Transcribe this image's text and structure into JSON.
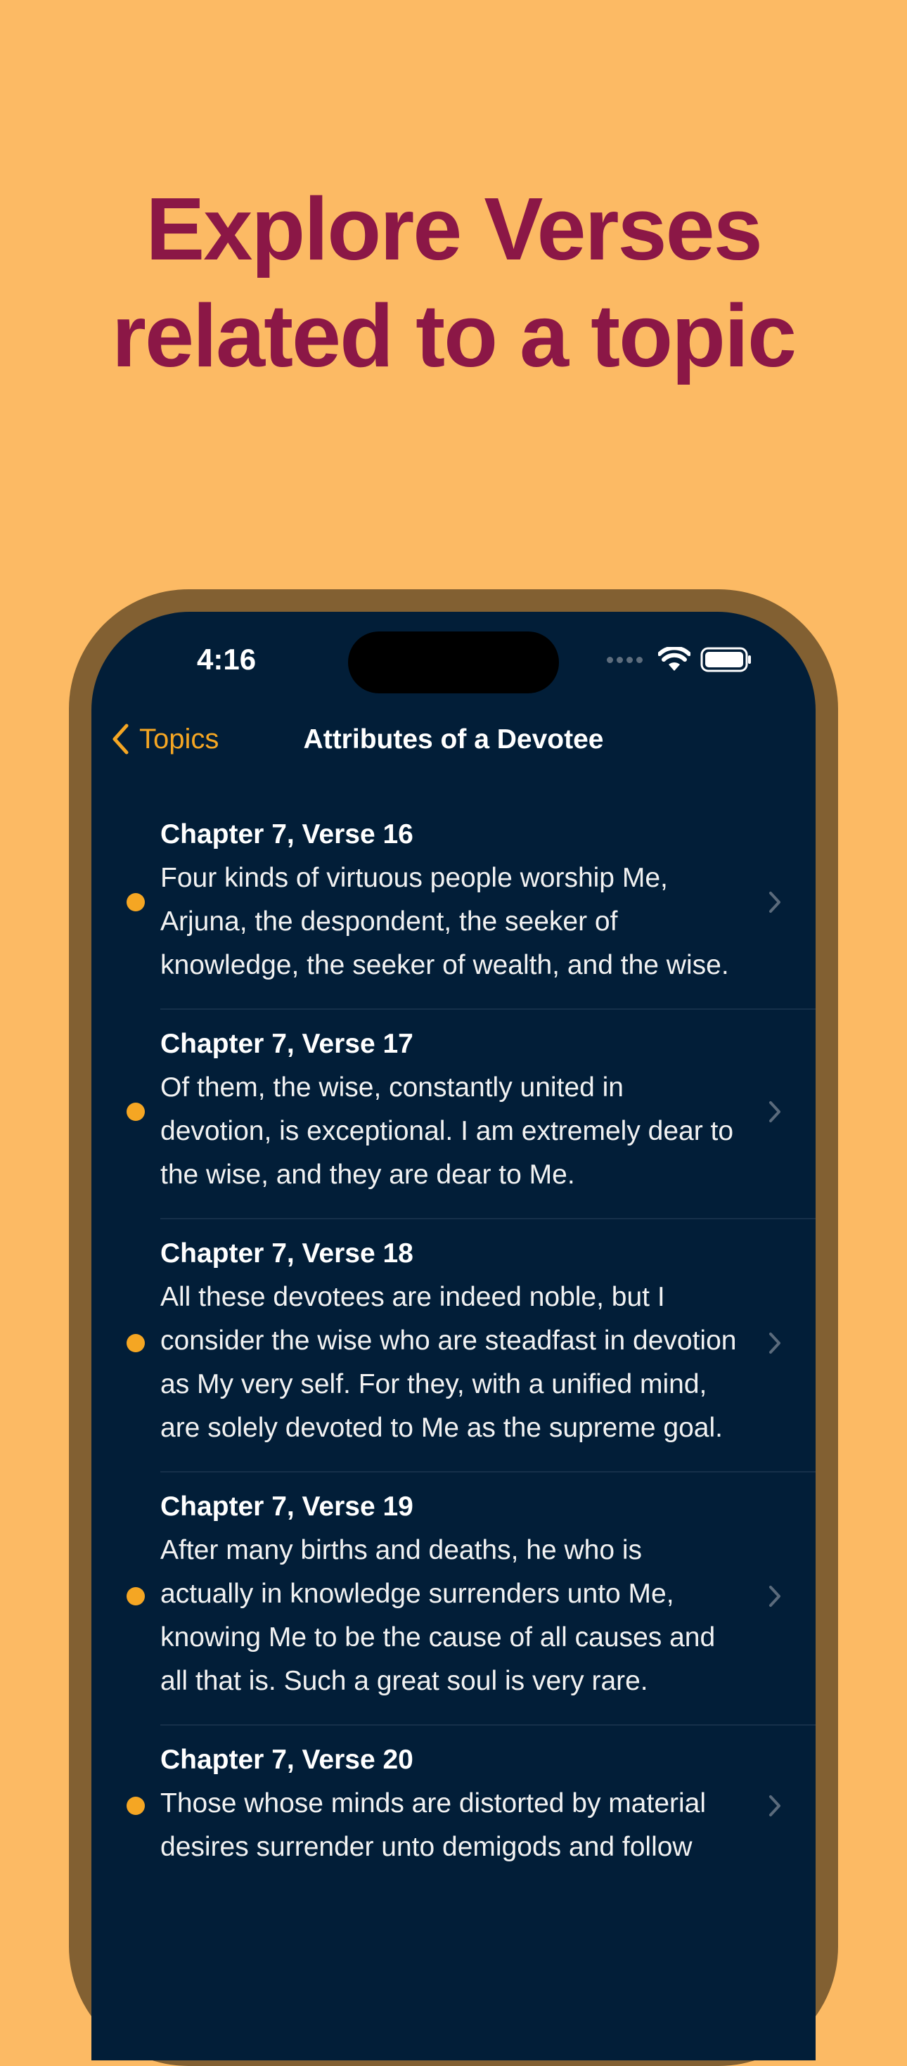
{
  "headline": {
    "line1": "Explore Verses",
    "line2": "related to a topic"
  },
  "colors": {
    "background": "#FCBA64",
    "headline": "#8B1746",
    "phone_frame": "#826032",
    "screen": "#021E38",
    "accent": "#F5A623"
  },
  "status_bar": {
    "time": "4:16"
  },
  "nav": {
    "back_label": "Topics",
    "title": "Attributes of a Devotee"
  },
  "verses": [
    {
      "title": "Chapter 7, Verse 16",
      "text": "Four kinds of virtuous people worship Me, Arjuna, the despondent, the seeker of knowledge, the seeker of wealth, and the wise."
    },
    {
      "title": "Chapter 7, Verse 17",
      "text": "Of them, the wise, constantly united in devotion, is exceptional. I am extremely dear to the wise, and they are dear to Me."
    },
    {
      "title": "Chapter 7, Verse 18",
      "text": "All these devotees are indeed noble, but I consider the wise who are steadfast in devotion as My very self. For they, with a unified mind, are solely devoted to Me as the supreme goal."
    },
    {
      "title": "Chapter 7, Verse 19",
      "text": "After many births and deaths, he who is actually in knowledge surrenders unto Me, knowing Me to be the cause of all causes and all that is. Such a great soul is very rare."
    },
    {
      "title": "Chapter 7, Verse 20",
      "text": "Those whose minds are distorted by material desires surrender unto demigods and follow"
    }
  ]
}
